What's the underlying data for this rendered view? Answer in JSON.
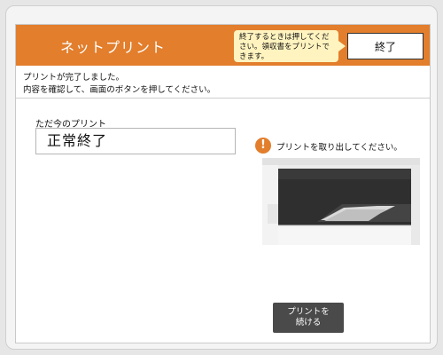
{
  "header": {
    "title": "ネットプリント",
    "note": "終了するときは押してください。領収書をプリントできます。",
    "end_label": "終了"
  },
  "main": {
    "message_line1": "プリントが完了しました。",
    "message_line2": "内容を確認して、画面のボタンを押してください。",
    "current_print_label": "ただ今のプリント",
    "status_value": "正常終了",
    "instruction": "プリントを取り出してください。",
    "continue_label": "プリントを\n続ける"
  },
  "colors": {
    "accent": "#e27e2c",
    "note_bg": "#fff3bf",
    "button_dark": "#4a4a4a"
  },
  "icons": [
    "warning-icon",
    "printer-illustration"
  ]
}
